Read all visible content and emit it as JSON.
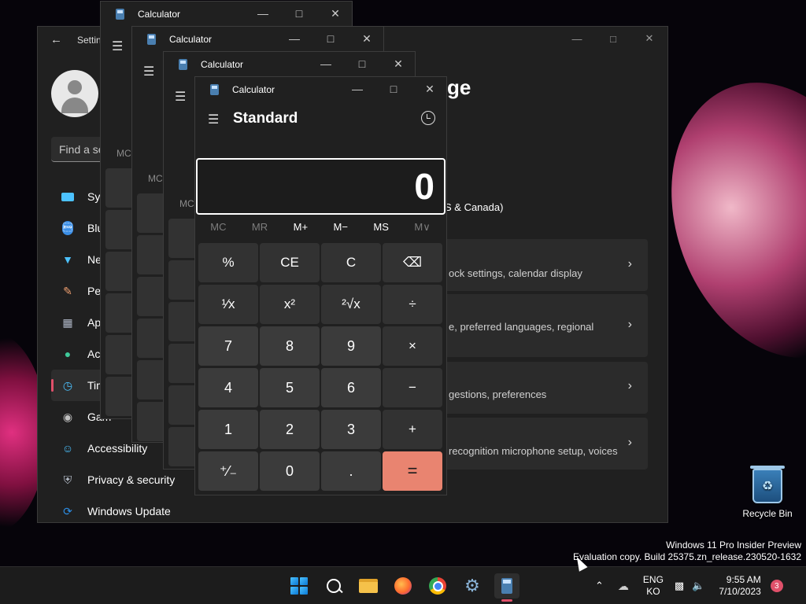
{
  "desktop": {
    "recycle_bin_label": "Recycle Bin",
    "watermark_line1": "Windows 11 Pro Insider Preview",
    "watermark_line2": "Evaluation copy. Build 25375.zn_release.230520-1632"
  },
  "settings": {
    "title": "Settin",
    "search_placeholder": "Find a se",
    "nav": [
      {
        "label": "Sys",
        "icon": "system-icon",
        "color": "#4cc2ff"
      },
      {
        "label": "Blu",
        "icon": "bluetooth-icon",
        "color": "#3a8ee6"
      },
      {
        "label": "Net",
        "icon": "wifi-icon",
        "color": "#4cc2ff"
      },
      {
        "label": "Per",
        "icon": "brush-icon",
        "color": "#f0a070"
      },
      {
        "label": "App",
        "icon": "apps-icon",
        "color": "#b0b8c8"
      },
      {
        "label": "Acc",
        "icon": "account-icon",
        "color": "#3fc99a"
      },
      {
        "label": "Tim",
        "icon": "time-language-icon",
        "color": "#4cc2ff"
      },
      {
        "label": "Gam",
        "icon": "gaming-icon",
        "color": "#c0c0c0"
      },
      {
        "label": "Accessibility",
        "icon": "accessibility-icon",
        "color": "#4cc2ff"
      },
      {
        "label": "Privacy & security",
        "icon": "shield-icon",
        "color": "#b8c0cc"
      },
      {
        "label": "Windows Update",
        "icon": "update-icon",
        "color": "#2c8ee6"
      }
    ],
    "header_fragment": "ge",
    "timezone_fragment": "S & Canada)",
    "cards": [
      {
        "desc": "ock settings, calendar display"
      },
      {
        "desc": "e, preferred languages, regional"
      },
      {
        "desc": "gestions, preferences"
      },
      {
        "desc": "recognition microphone setup, voices"
      }
    ]
  },
  "calc_back": [
    {
      "title": "Calculator"
    },
    {
      "title": "Calculator"
    },
    {
      "title": "Calculator"
    }
  ],
  "calculator": {
    "title": "Calculator",
    "mode": "Standard",
    "display": "0",
    "memory": [
      "MC",
      "MR",
      "M+",
      "M−",
      "MS",
      "M∨"
    ],
    "keys": [
      "%",
      "CE",
      "C",
      "⌫",
      "¹⁄x",
      "x²",
      "²√x",
      "÷",
      "7",
      "8",
      "9",
      "×",
      "4",
      "5",
      "6",
      "−",
      "1",
      "2",
      "3",
      "+",
      "⁺⁄₋",
      "0",
      ".",
      "="
    ],
    "back_mc": "MC"
  },
  "taskbar": {
    "lang_top": "ENG",
    "lang_bottom": "KO",
    "time": "9:55 AM",
    "date": "7/10/2023",
    "notification_count": "3"
  }
}
